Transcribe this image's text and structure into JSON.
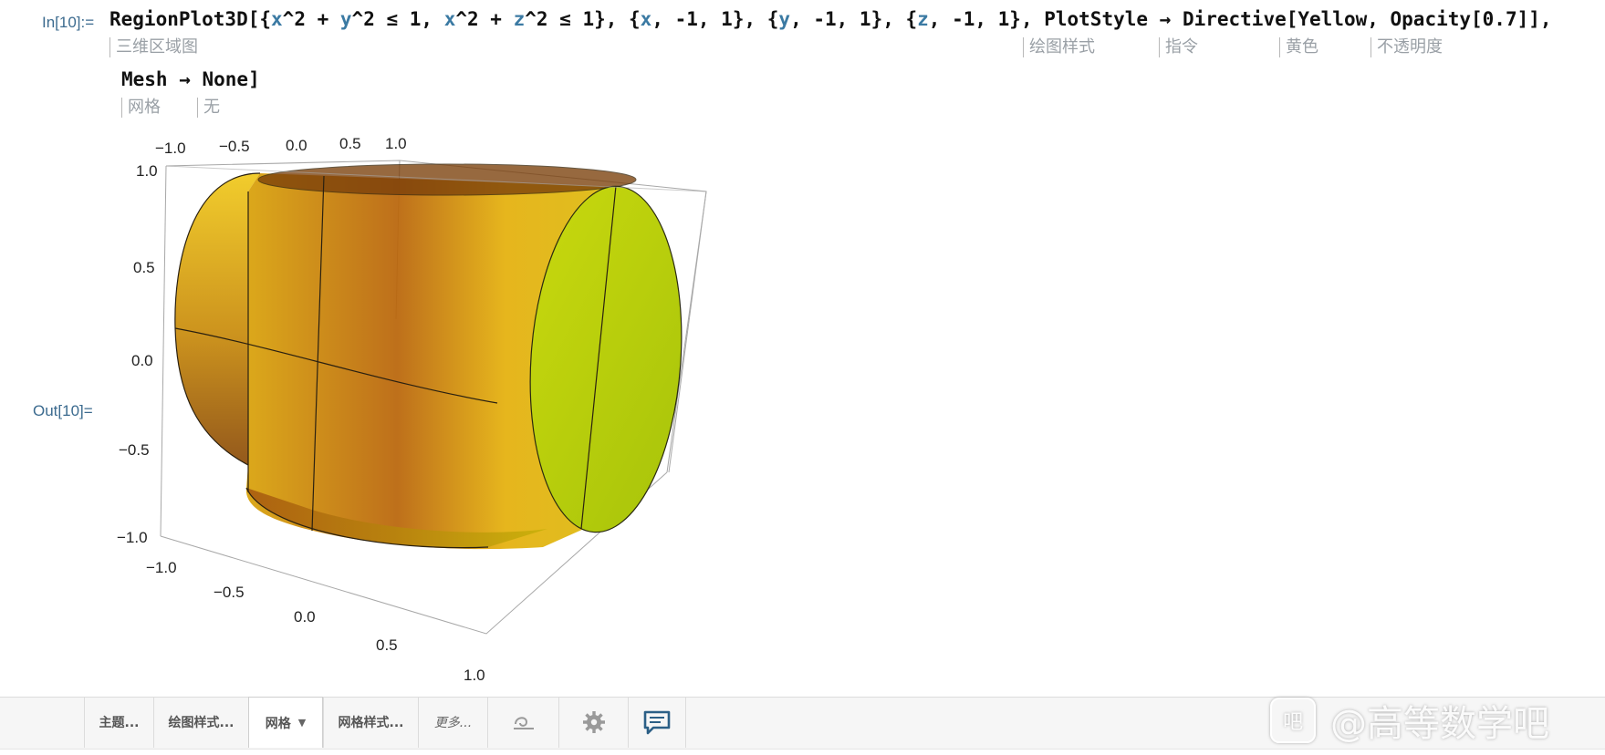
{
  "cell": {
    "in_label": "In[10]:=",
    "out_label": "Out[10]=",
    "code_line1": [
      {
        "t": "RegionPlot3D[{",
        "v": false
      },
      {
        "t": "x",
        "v": true
      },
      {
        "t": "^2 + ",
        "v": false
      },
      {
        "t": "y",
        "v": true
      },
      {
        "t": "^2 ≤ 1, ",
        "v": false
      },
      {
        "t": "x",
        "v": true
      },
      {
        "t": "^2 + ",
        "v": false
      },
      {
        "t": "z",
        "v": true
      },
      {
        "t": "^2 ≤ 1}, {",
        "v": false
      },
      {
        "t": "x",
        "v": true
      },
      {
        "t": ", -1, 1}, {",
        "v": false
      },
      {
        "t": "y",
        "v": true
      },
      {
        "t": ", -1, 1}, {",
        "v": false
      },
      {
        "t": "z",
        "v": true
      },
      {
        "t": ", -1, 1}, PlotStyle → Directive[Yellow, Opacity[0.7]],",
        "v": false
      }
    ],
    "code_line2": "Mesh → None]",
    "hints": {
      "regionplot": "三维区域图",
      "plotstyle": "绘图样式",
      "directive": "指令",
      "yellow": "黄色",
      "opacity": "不透明度",
      "mesh": "网格",
      "none": "无"
    }
  },
  "plot": {
    "x_ticks": [
      "−1.0",
      "−0.5",
      "0.0",
      "0.5",
      "1.0"
    ],
    "y_ticks": [
      "−1.0",
      "−0.5",
      "0.0",
      "0.5",
      "1.0"
    ],
    "z_ticks": [
      "1.0",
      "0.5",
      "0.0",
      "−0.5",
      "−1.0"
    ],
    "colors": {
      "surface_yellow": "#e6c200",
      "surface_orange": "#c27d0a",
      "cap_green": "#b9d40a",
      "box": "#a0a0a0"
    }
  },
  "toolbar": {
    "theme": "主题...",
    "plot_style": "绘图样式...",
    "mesh": "网格",
    "mesh_style": "网格样式...",
    "more": "更多...",
    "icons": [
      "swirl-icon",
      "gear-icon",
      "chat-bubble-icon"
    ]
  },
  "watermark": {
    "text": "@高等数学吧",
    "logo_text": "吧"
  }
}
